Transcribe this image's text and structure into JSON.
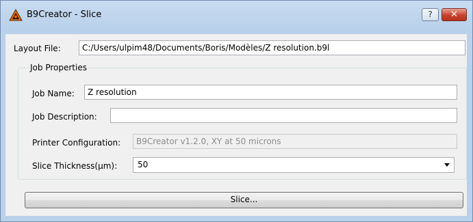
{
  "window": {
    "title": "B9Creator - Slice",
    "help_label": "?",
    "close_label": "✕"
  },
  "layout_file": {
    "label": "Layout File:",
    "value": "C:/Users/ulpim48/Documents/Boris/Modèles/Z resolution.b9l"
  },
  "job_properties": {
    "title": "Job Properties",
    "job_name": {
      "label": "Job Name:",
      "value": "Z resolution"
    },
    "job_description": {
      "label": "Job Description:",
      "value": ""
    },
    "printer_configuration": {
      "label": "Printer Configuration:",
      "value": "B9Creator v1.2.0, XY at 50 microns"
    },
    "slice_thickness": {
      "label": "Slice Thickness(µm):",
      "selected": "50"
    }
  },
  "slice_button": {
    "label": "Slice..."
  }
}
